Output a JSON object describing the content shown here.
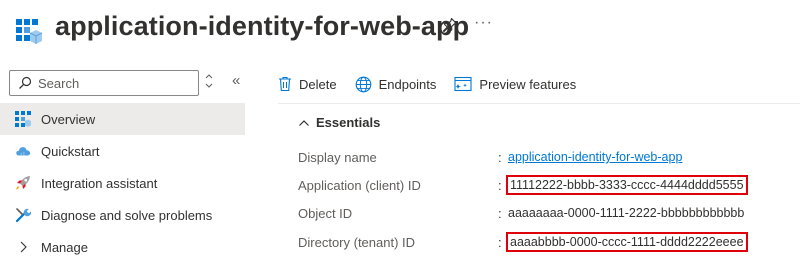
{
  "header": {
    "title": "application-identity-for-web-app",
    "pin_icon": "pin-icon",
    "more_label": "···"
  },
  "sidebar": {
    "search": {
      "placeholder": "Search"
    },
    "collapse_chevron": "«",
    "items": [
      {
        "label": "Overview",
        "icon": "overview-grid-icon",
        "active": true
      },
      {
        "label": "Quickstart",
        "icon": "cloud-icon",
        "active": false
      },
      {
        "label": "Integration assistant",
        "icon": "rocket-icon",
        "active": false
      },
      {
        "label": "Diagnose and solve problems",
        "icon": "wrench-icon",
        "active": false
      },
      {
        "label": "Manage",
        "icon": "chevron-right-icon",
        "active": false
      }
    ]
  },
  "toolbar": {
    "delete_label": "Delete",
    "endpoints_label": "Endpoints",
    "preview_label": "Preview features"
  },
  "essentials": {
    "header": "Essentials",
    "rows": [
      {
        "label": "Display name",
        "value": "application-identity-for-web-app",
        "is_link": true,
        "highlighted": false
      },
      {
        "label": "Application (client) ID",
        "value": "11112222-bbbb-3333-cccc-4444dddd5555",
        "is_link": false,
        "highlighted": true
      },
      {
        "label": "Object ID",
        "value": "aaaaaaaa-0000-1111-2222-bbbbbbbbbbbb",
        "is_link": false,
        "highlighted": false
      },
      {
        "label": "Directory (tenant) ID",
        "value": "aaaabbbb-0000-cccc-1111-dddd2222eeee",
        "is_link": false,
        "highlighted": true
      }
    ]
  },
  "colors": {
    "accent": "#0078d4",
    "highlight_border": "#e0000b",
    "active_nav_bg": "#edebe9"
  }
}
